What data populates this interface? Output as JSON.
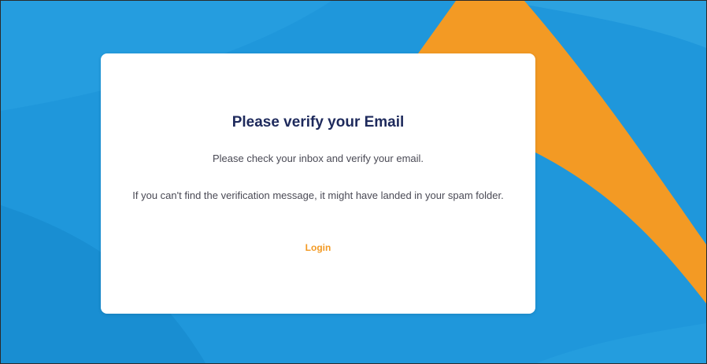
{
  "verify_card": {
    "title": "Please verify your Email",
    "line1": "Please check your inbox and verify your email.",
    "line2": "If you can't find the verification message, it might have landed in your spam folder.",
    "login_label": "Login"
  },
  "colors": {
    "background_blue": "#1f97db",
    "accent_orange": "#f39a24",
    "title_navy": "#1e2a5c",
    "body_text": "#4a4a55",
    "card_bg": "#ffffff"
  }
}
